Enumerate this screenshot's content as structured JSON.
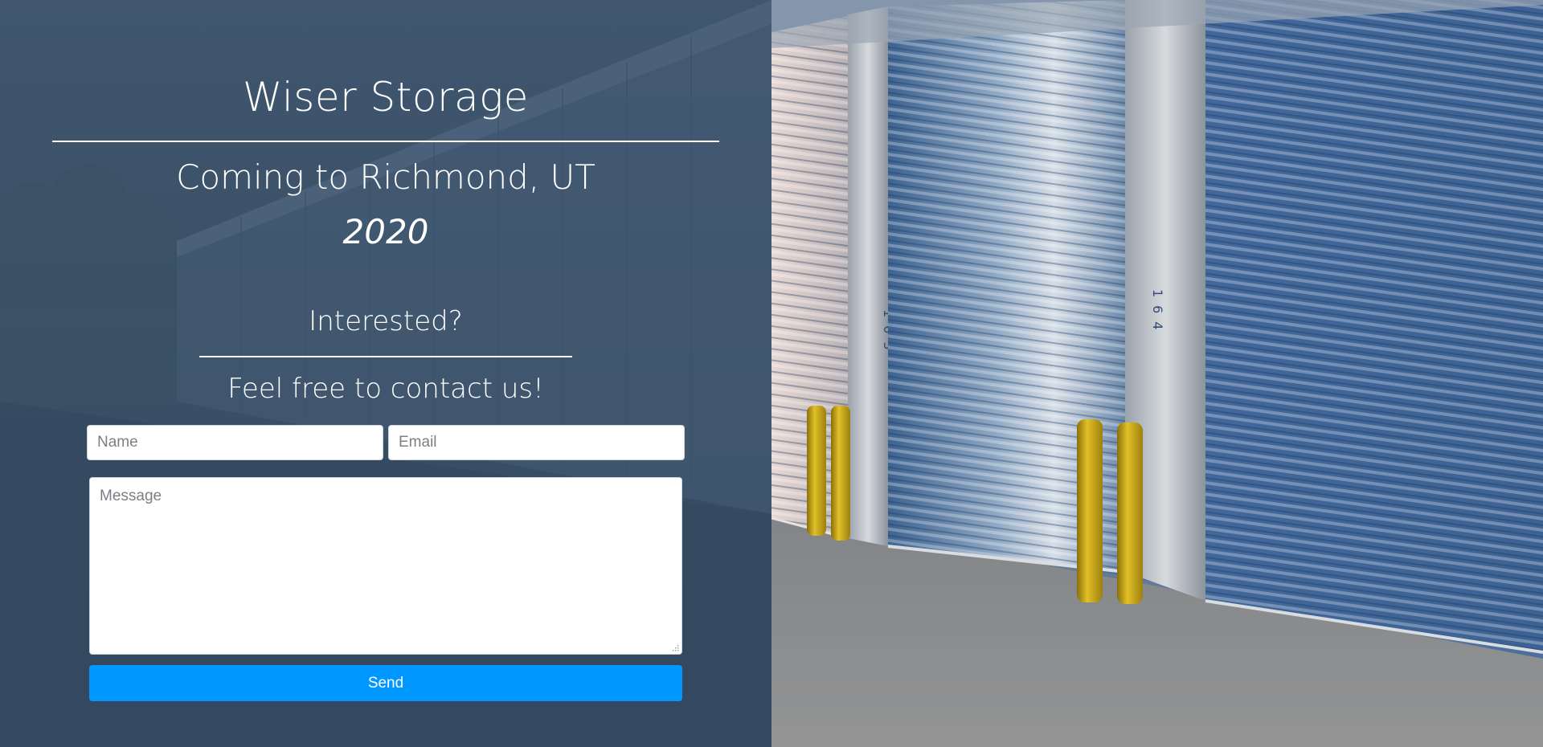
{
  "hero": {
    "brand_title": "Wiser Storage",
    "coming_text": "Coming to Richmond, UT",
    "year": "2020"
  },
  "contact": {
    "heading": "Interested?",
    "subheading": "Feel free to contact us!",
    "name_placeholder": "Name",
    "email_placeholder": "Email",
    "message_placeholder": "Message",
    "send_label": "Send"
  },
  "photo": {
    "unit_numbers": [
      "163",
      "164"
    ]
  },
  "colors": {
    "left_overlay": "#3a5068",
    "send_button": "#0098ff",
    "door_blue": "#4c6f9b",
    "bollard_yellow": "#d8b317"
  }
}
